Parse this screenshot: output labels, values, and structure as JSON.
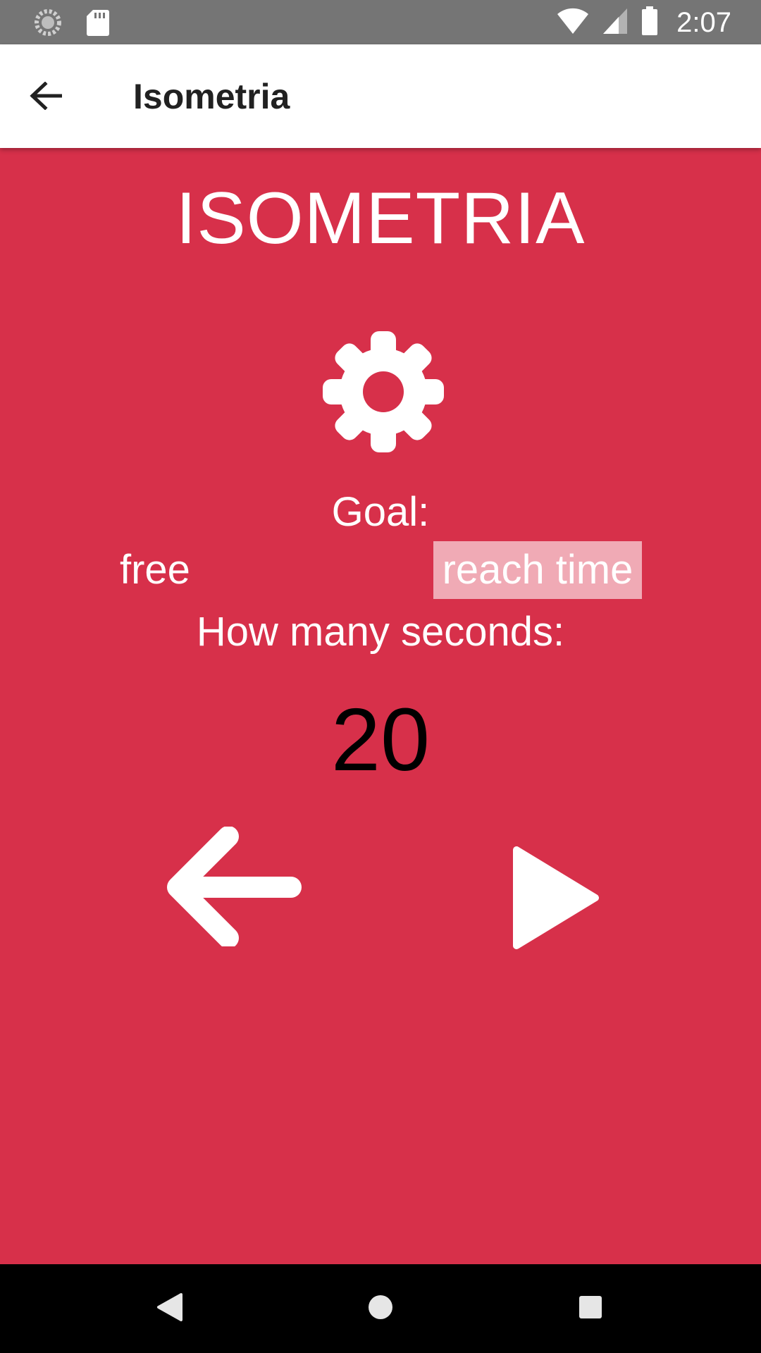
{
  "status_bar": {
    "time": "2:07",
    "icons": [
      "sync-icon",
      "sd-card-icon",
      "wifi-icon",
      "cell-signal-icon",
      "battery-icon"
    ]
  },
  "app_bar": {
    "title": "Isometria",
    "back_icon": "arrow-back-icon"
  },
  "main": {
    "heading": "ISOMETRIA",
    "settings_icon": "gear-icon",
    "goal_label": "Goal:",
    "options": [
      {
        "label": "free",
        "selected": false
      },
      {
        "label": "reach time",
        "selected": true
      }
    ],
    "seconds_label": "How many seconds:",
    "seconds_value": "20",
    "back_icon": "arrow-left-icon",
    "play_icon": "play-icon"
  },
  "nav_bar": {
    "buttons": [
      "nav-back-icon",
      "nav-home-icon",
      "nav-recents-icon"
    ]
  },
  "colors": {
    "background": "#d7304a",
    "status_bar": "#757575",
    "app_bar": "#ffffff",
    "selected_option": "#f0aab5",
    "nav_bar": "#000000"
  }
}
